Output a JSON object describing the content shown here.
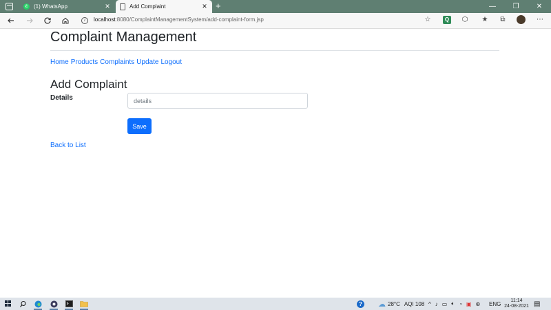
{
  "browser": {
    "tabs": [
      {
        "title": "(1) WhatsApp",
        "icon": "whatsapp-icon"
      },
      {
        "title": "Add Complaint",
        "icon": "page-icon"
      }
    ],
    "close_glyph": "✕",
    "new_tab_glyph": "+",
    "window_controls": {
      "minimize": "—",
      "restore": "❐",
      "close": "✕"
    },
    "url_host": "localhost",
    "url_rest": ":8080/ComplaintManagementSystem/add-complaint-form.jsp",
    "info_glyph": "i"
  },
  "page": {
    "title": "Complaint Management",
    "nav": [
      "Home",
      "Products",
      "Complaints",
      "Update",
      "Logout"
    ],
    "section_title": "Add Complaint",
    "form": {
      "details_label": "Details",
      "details_placeholder": "details",
      "details_value": "",
      "save_label": "Save"
    },
    "back_link": "Back to List"
  },
  "taskbar": {
    "weather_temp": "28°C",
    "aqi": "AQI 108",
    "language": "ENG",
    "time": "11:14",
    "date": "24-08-2021"
  },
  "colors": {
    "tabstrip": "#5f7f72",
    "link": "#0d6efd",
    "primary_button": "#0d6efd",
    "taskbar": "#dfe4ea"
  }
}
